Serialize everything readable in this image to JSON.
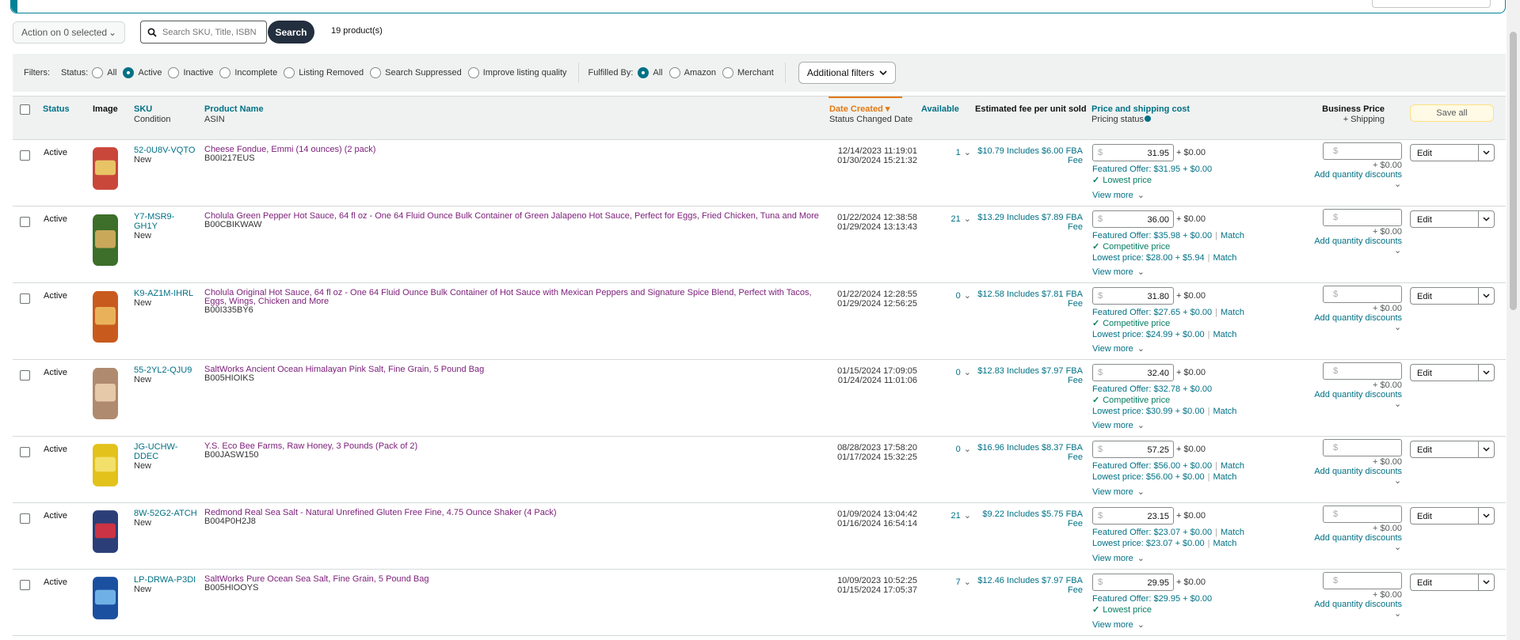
{
  "toolbar": {
    "action_label": "Action on 0 selected",
    "search_placeholder": "Search SKU, Title, ISBN",
    "search_button": "Search",
    "product_count": "19 product(s)"
  },
  "filters": {
    "label": "Filters:",
    "status_label": "Status:",
    "status_options": [
      {
        "label": "All",
        "selected": false
      },
      {
        "label": "Active",
        "selected": true
      },
      {
        "label": "Inactive",
        "selected": false
      },
      {
        "label": "Incomplete",
        "selected": false
      },
      {
        "label": "Listing Removed",
        "selected": false
      },
      {
        "label": "Search Suppressed",
        "selected": false
      },
      {
        "label": "Improve listing quality",
        "selected": false
      }
    ],
    "fulfilled_label": "Fulfilled By:",
    "fulfilled_options": [
      {
        "label": "All",
        "selected": true
      },
      {
        "label": "Amazon",
        "selected": false
      },
      {
        "label": "Merchant",
        "selected": false
      }
    ],
    "additional_filters": "Additional filters"
  },
  "columns": {
    "status": "Status",
    "image": "Image",
    "sku": "SKU",
    "condition": "Condition",
    "product_name": "Product Name",
    "asin": "ASIN",
    "date_created": "Date Created",
    "status_changed": "Status Changed Date",
    "available": "Available",
    "fee": "Estimated fee per unit sold",
    "price": "Price and shipping cost",
    "pricing_status": "Pricing status",
    "business_price": "Business Price",
    "plus_shipping": "+ Shipping",
    "save_all": "Save all"
  },
  "common": {
    "currency": "$",
    "ship": "+ $0.00",
    "view_more": "View more",
    "add_qty": "Add quantity discounts",
    "bp_ship": "+ $0.00",
    "edit": "Edit",
    "fee_suffix": "Fee",
    "match": "Match",
    "pipe": "|"
  },
  "rows": [
    {
      "status": "Active",
      "sku": "52-0U8V-VQTO",
      "condition": "New",
      "name": "Cheese Fondue, Emmi (14 ounces) (2 pack)",
      "asin": "B00I217EUS",
      "created": "12/14/2023 11:19:01",
      "changed": "01/30/2024 15:21:32",
      "available": "1",
      "fee": "$10.79 Includes $6.00 FBA",
      "price": "31.95",
      "featured": "Featured Offer: $31.95 + $0.00",
      "featured_match": false,
      "status_msg": "Lowest price",
      "lowest": "",
      "lowest_match": false
    },
    {
      "status": "Active",
      "sku": "Y7-MSR9-GH1Y",
      "condition": "New",
      "name": "Cholula Green Pepper Hot Sauce, 64 fl oz - One 64 Fluid Ounce Bulk Container of Green Jalapeno Hot Sauce, Perfect for Eggs, Fried Chicken, Tuna and More",
      "asin": "B00CBIKWAW",
      "created": "01/22/2024 12:38:58",
      "changed": "01/29/2024 13:13:43",
      "available": "21",
      "fee": "$13.29 Includes $7.89 FBA",
      "price": "36.00",
      "featured": "Featured Offer: $35.98 + $0.00",
      "featured_match": true,
      "status_msg": "Competitive price",
      "lowest": "Lowest price: $28.00 + $5.94",
      "lowest_match": true
    },
    {
      "status": "Active",
      "sku": "K9-AZ1M-IHRL",
      "condition": "New",
      "name": "Cholula Original Hot Sauce, 64 fl oz - One 64 Fluid Ounce Bulk Container of Hot Sauce with Mexican Peppers and Signature Spice Blend, Perfect with Tacos, Eggs, Wings, Chicken and More",
      "asin": "B00I335BY6",
      "created": "01/22/2024 12:28:55",
      "changed": "01/29/2024 12:56:25",
      "available": "0",
      "fee": "$12.58 Includes $7.81 FBA",
      "price": "31.80",
      "featured": "Featured Offer: $27.65 + $0.00",
      "featured_match": true,
      "status_msg": "Competitive price",
      "lowest": "Lowest price: $24.99 + $0.00",
      "lowest_match": true
    },
    {
      "status": "Active",
      "sku": "55-2YL2-QJU9",
      "condition": "New",
      "name": "SaltWorks Ancient Ocean Himalayan Pink Salt, Fine Grain, 5 Pound Bag",
      "asin": "B005HIOIKS",
      "created": "01/15/2024 17:09:05",
      "changed": "01/24/2024 11:01:06",
      "available": "0",
      "fee": "$12.83 Includes $7.97 FBA",
      "price": "32.40",
      "featured": "Featured Offer: $32.78 + $0.00",
      "featured_match": false,
      "status_msg": "Competitive price",
      "lowest": "Lowest price: $30.99 + $0.00",
      "lowest_match": true
    },
    {
      "status": "Active",
      "sku": "JG-UCHW-DDEC",
      "condition": "New",
      "name": "Y.S. Eco Bee Farms, Raw Honey, 3 Pounds (Pack of 2)",
      "asin": "B00JASW150",
      "created": "08/28/2023 17:58:20",
      "changed": "01/17/2024 15:32:25",
      "available": "0",
      "fee": "$16.96 Includes $8.37 FBA",
      "price": "57.25",
      "featured": "Featured Offer: $56.00 + $0.00",
      "featured_match": true,
      "status_msg": "",
      "lowest": "Lowest price: $56.00 + $0.00",
      "lowest_match": true
    },
    {
      "status": "Active",
      "sku": "8W-52G2-ATCH",
      "condition": "New",
      "name": "Redmond Real Sea Salt - Natural Unrefined Gluten Free Fine, 4.75 Ounce Shaker (4 Pack)",
      "asin": "B004P0H2J8",
      "created": "01/09/2024 13:04:42",
      "changed": "01/16/2024 16:54:14",
      "available": "21",
      "fee": "$9.22 Includes $5.75 FBA",
      "price": "23.15",
      "featured": "Featured Offer: $23.07 + $0.00",
      "featured_match": true,
      "status_msg": "",
      "lowest": "Lowest price: $23.07 + $0.00",
      "lowest_match": true
    },
    {
      "status": "Active",
      "sku": "LP-DRWA-P3DI",
      "condition": "New",
      "name": "SaltWorks Pure Ocean Sea Salt, Fine Grain, 5 Pound Bag",
      "asin": "B005HIOOYS",
      "created": "10/09/2023 10:52:25",
      "changed": "01/15/2024 17:05:37",
      "available": "7",
      "fee": "$12.46 Includes $7.97 FBA",
      "price": "29.95",
      "featured": "Featured Offer: $29.95 + $0.00",
      "featured_match": false,
      "status_msg": "Lowest price",
      "lowest": "",
      "lowest_match": false
    }
  ]
}
